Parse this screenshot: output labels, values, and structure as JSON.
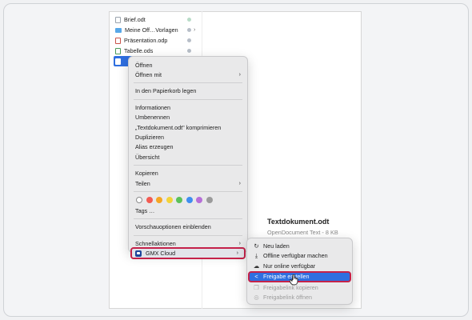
{
  "files": [
    {
      "name": "Brief.odt",
      "type": "doc",
      "sync": "green",
      "chevron": ""
    },
    {
      "name": "Meine Off…Vorlagen",
      "type": "folder",
      "sync": "grey",
      "chevron": "›"
    },
    {
      "name": "Präsentation.odp",
      "type": "ppt",
      "sync": "grey",
      "chevron": ""
    },
    {
      "name": "Tabelle.ods",
      "type": "ods",
      "sync": "grey",
      "chevron": ""
    }
  ],
  "context_menu": {
    "group1": [
      {
        "label": "Öffnen",
        "arrow": ""
      },
      {
        "label": "Öffnen mit",
        "arrow": "›"
      }
    ],
    "group2": [
      {
        "label": "In den Papierkorb legen",
        "arrow": ""
      }
    ],
    "group3": [
      {
        "label": "Informationen",
        "arrow": ""
      },
      {
        "label": "Umbenennen",
        "arrow": ""
      },
      {
        "label": "„Textdokument.odt\" komprimieren",
        "arrow": ""
      },
      {
        "label": "Duplizieren",
        "arrow": ""
      },
      {
        "label": "Alias erzeugen",
        "arrow": ""
      },
      {
        "label": "Übersicht",
        "arrow": ""
      }
    ],
    "group4": [
      {
        "label": "Kopieren",
        "arrow": ""
      },
      {
        "label": "Teilen",
        "arrow": "›"
      }
    ],
    "tag_colors": [
      "#ffffff",
      "#f35b52",
      "#f5a623",
      "#f3d33a",
      "#5cc15a",
      "#3f8ef0",
      "#b76fd8",
      "#9b9b9b"
    ],
    "tags_label": "Tags …",
    "preview_options": "Vorschauoptionen einblenden",
    "quick_actions": "Schnellaktionen",
    "gmx_cloud": "GMX Cloud"
  },
  "submenu": [
    {
      "label": "Neu laden",
      "icon": "↻",
      "disabled": false,
      "highlight": false
    },
    {
      "label": "Offline verfügbar machen",
      "icon": "⤓",
      "disabled": false,
      "highlight": false
    },
    {
      "label": "Nur online verfügbar",
      "icon": "☁",
      "disabled": false,
      "highlight": false
    },
    {
      "label": "Freigabe erstellen",
      "icon": "<",
      "disabled": false,
      "highlight": true
    },
    {
      "label": "Freigabelink kopieren",
      "icon": "❐",
      "disabled": true,
      "highlight": false
    },
    {
      "label": "Freigabelink öffnen",
      "icon": "◎",
      "disabled": true,
      "highlight": false
    }
  ],
  "preview": {
    "title": "Textdokument.odt",
    "subtitle": "OpenDocument Text - 8 KB"
  },
  "colors": {
    "accent": "#2f6fe0",
    "highlight_outline": "#c4224a"
  }
}
